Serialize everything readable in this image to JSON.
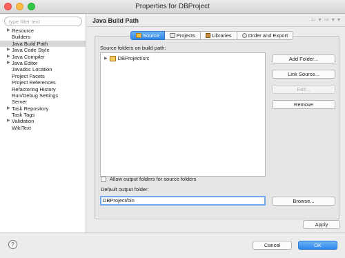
{
  "window": {
    "title": "Properties for DBProject"
  },
  "filter": {
    "placeholder": "type filter text"
  },
  "tree": [
    {
      "label": "Resource",
      "expandable": true
    },
    {
      "label": "Builders",
      "expandable": false
    },
    {
      "label": "Java Build Path",
      "expandable": false,
      "selected": true
    },
    {
      "label": "Java Code Style",
      "expandable": true
    },
    {
      "label": "Java Compiler",
      "expandable": true
    },
    {
      "label": "Java Editor",
      "expandable": true
    },
    {
      "label": "Javadoc Location",
      "expandable": false
    },
    {
      "label": "Project Facets",
      "expandable": false
    },
    {
      "label": "Project References",
      "expandable": false
    },
    {
      "label": "Refactoring History",
      "expandable": false
    },
    {
      "label": "Run/Debug Settings",
      "expandable": false
    },
    {
      "label": "Server",
      "expandable": false
    },
    {
      "label": "Task Repository",
      "expandable": true
    },
    {
      "label": "Task Tags",
      "expandable": false
    },
    {
      "label": "Validation",
      "expandable": true
    },
    {
      "label": "WikiText",
      "expandable": false
    }
  ],
  "page": {
    "title": "Java Build Path",
    "nav": "⇦ ▾ ⇨ ▾ ▾"
  },
  "tabs": [
    {
      "label": "Source",
      "icon": "source-folder-icon",
      "active": true
    },
    {
      "label": "Projects",
      "icon": "projects-icon",
      "active": false
    },
    {
      "label": "Libraries",
      "icon": "libraries-icon",
      "active": false
    },
    {
      "label": "Order and Export",
      "icon": "order-export-icon",
      "active": false
    }
  ],
  "source": {
    "section_label": "Source folders on build path:",
    "items": [
      {
        "label": "DBProject/src",
        "icon": "package-folder-icon"
      }
    ],
    "buttons": {
      "add_folder": "Add Folder...",
      "link_source": "Link Source...",
      "edit": "Edit...",
      "remove": "Remove"
    },
    "allow_output_label": "Allow output folders for source folders",
    "allow_output_checked": false,
    "default_output_label": "Default output folder:",
    "default_output_value": "DBProject/bin",
    "browse": "Browse..."
  },
  "footer": {
    "apply": "Apply",
    "help": "?",
    "cancel": "Cancel",
    "ok": "OK"
  }
}
